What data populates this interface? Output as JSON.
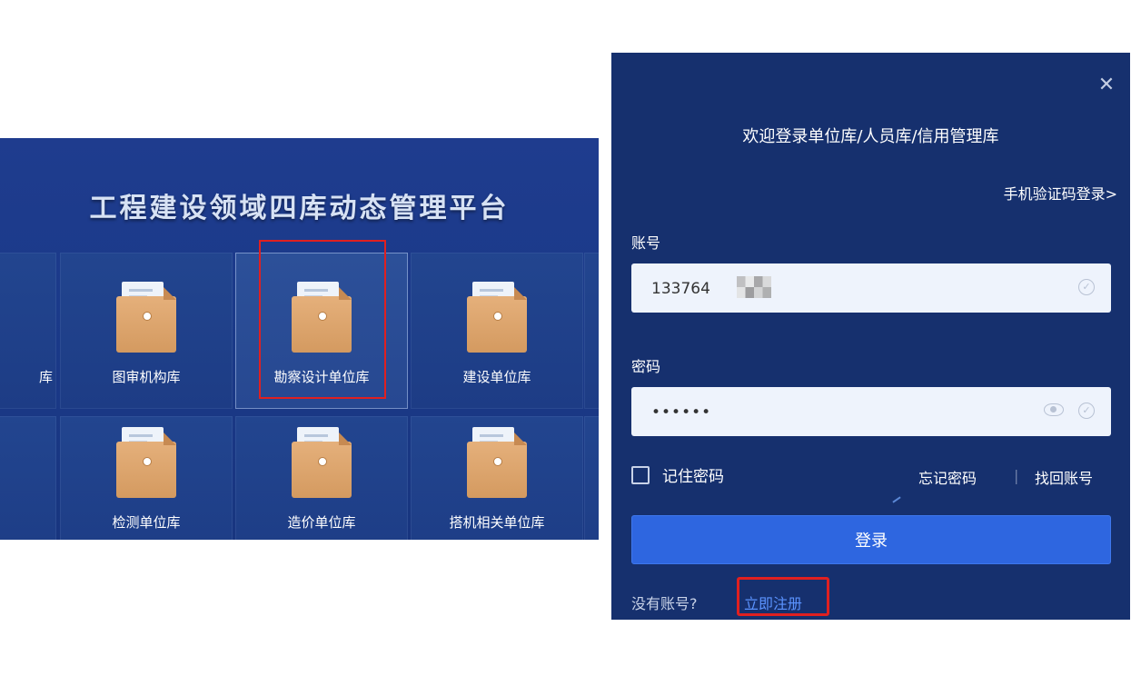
{
  "left": {
    "title": "工程建设领域四库动态管理平台",
    "tiles": [
      {
        "label": "图审机构库"
      },
      {
        "label": "勘察设计单位库"
      },
      {
        "label": "建设单位库"
      },
      {
        "label": "检测单位库"
      },
      {
        "label": "造价单位库"
      },
      {
        "label": "搭机相关单位库"
      }
    ],
    "edge_fragment": "库"
  },
  "login": {
    "welcome": "欢迎登录单位库/人员库/信用管理库",
    "sms_login": "手机验证码登录>",
    "account_label": "账号",
    "account_value": "133764",
    "password_label": "密码",
    "password_value": "••••••",
    "remember_label": "记住密码",
    "forgot_password": "忘记密码",
    "divider": "|",
    "recover_account": "找回账号",
    "login_button": "登录",
    "no_account": "没有账号?",
    "register": "立即注册",
    "close_glyph": "✕",
    "check_glyph": "✓"
  },
  "colors": {
    "panel_bg": "#16306e",
    "left_bg": "#1b3a8a",
    "primary_button": "#2e66e0",
    "register_link": "#5b93ff",
    "annotation_red": "#e02020"
  }
}
